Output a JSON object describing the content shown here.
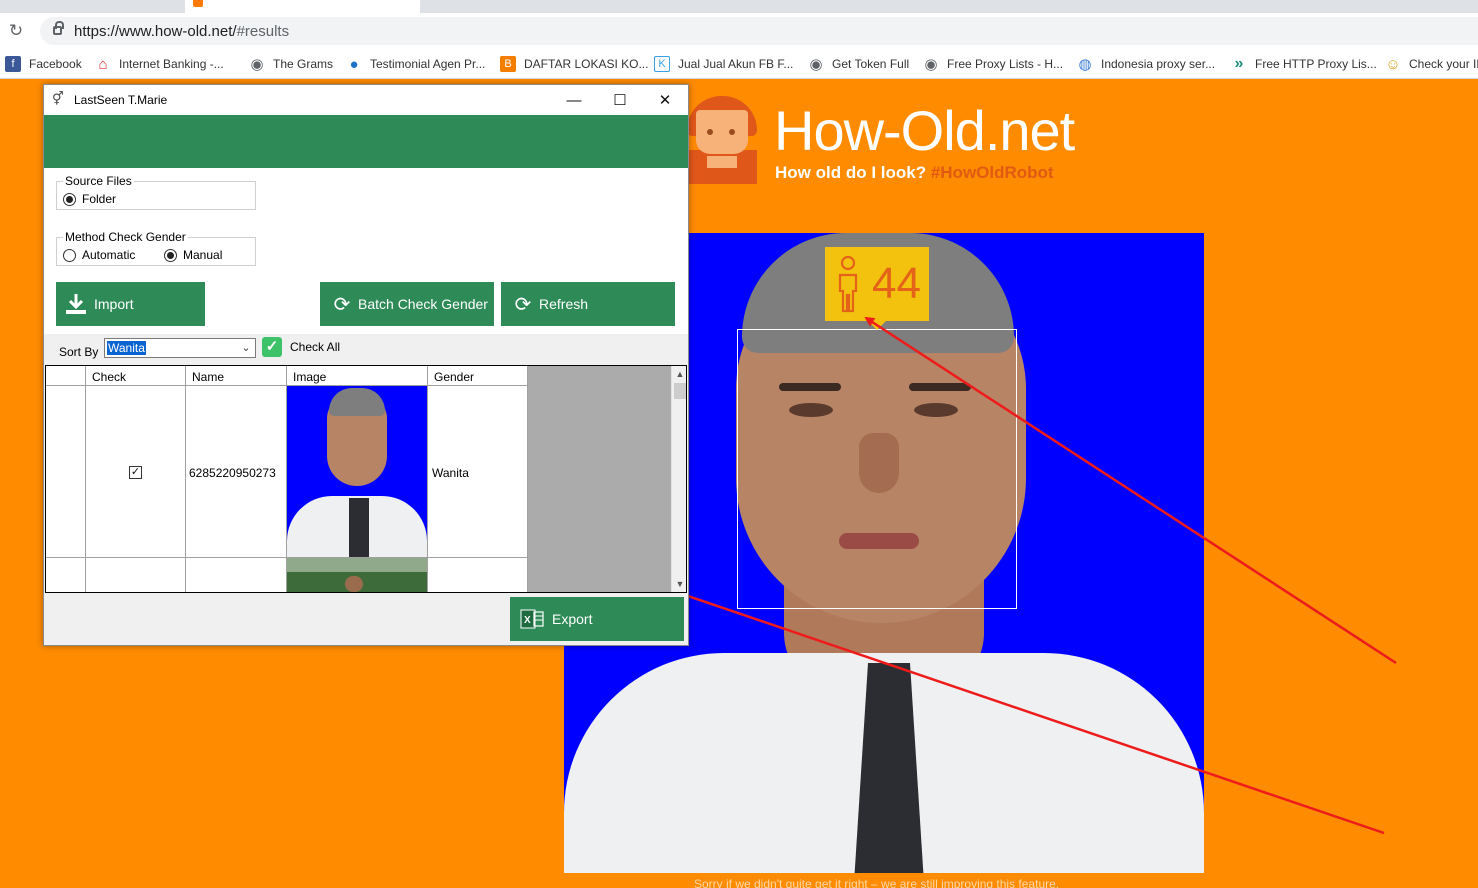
{
  "browser": {
    "url_host": "https://www.how-old.net/",
    "url_hash": "#results",
    "bookmarks": [
      {
        "label": "Facebook",
        "icon": "facebook-icon",
        "color": "#3b5998",
        "glyph": "f"
      },
      {
        "label": "Internet Banking -...",
        "icon": "home-icon",
        "color": "#e22c2c",
        "glyph": "⌂"
      },
      {
        "label": "The Grams",
        "icon": "globe-icon",
        "color": "#5f6368",
        "glyph": "◉"
      },
      {
        "label": "Testimonial Agen Pr...",
        "icon": "pin-icon",
        "color": "#1e73c8",
        "glyph": "●"
      },
      {
        "label": "DAFTAR LOKASI KO...",
        "icon": "blogger-icon",
        "color": "#f57d00",
        "glyph": "B"
      },
      {
        "label": "Jual Jual Akun FB F...",
        "icon": "k-icon",
        "color": "#3aa0e8",
        "glyph": "K"
      },
      {
        "label": "Get Token Full",
        "icon": "globe-icon",
        "color": "#5f6368",
        "glyph": "◉"
      },
      {
        "label": "Free Proxy Lists - H...",
        "icon": "globe-icon",
        "color": "#5f6368",
        "glyph": "◉"
      },
      {
        "label": "Indonesia proxy ser...",
        "icon": "world-icon",
        "color": "#3a7bd5",
        "glyph": "◍"
      },
      {
        "label": "Free HTTP Proxy Lis...",
        "icon": "chevrons-icon",
        "color": "#1f8f7a",
        "glyph": "»"
      },
      {
        "label": "Check your IP",
        "icon": "face-icon",
        "color": "#d9a21b",
        "glyph": "☺"
      }
    ]
  },
  "site": {
    "title": "How-Old.net",
    "subtitle": "How old do I look?",
    "hashtag": "#HowOldRobot",
    "age": "44",
    "footnote": "Sorry if we didn't quite get it right – we are still improving this feature."
  },
  "app": {
    "title": "LastSeen T.Marie",
    "source_group": "Source Files",
    "source_option": "Folder",
    "method_group": "Method Check Gender",
    "method_automatic": "Automatic",
    "method_manual": "Manual",
    "import_label": "Import",
    "batch_label": "Batch Check Gender",
    "refresh_label": "Refresh",
    "sort_label": "Sort By",
    "sort_value": "Wanita",
    "check_all_label": "Check All",
    "export_label": "Export",
    "columns": [
      "Check",
      "Name",
      "Image",
      "Gender"
    ],
    "rows": [
      {
        "checked": true,
        "name": "6285220950273",
        "gender": "Wanita"
      },
      {
        "checked": false,
        "name": "",
        "gender": ""
      }
    ]
  },
  "colors": {
    "page_bg": "#fe8b00",
    "app_green": "#2e8a57",
    "age_badge": "#f2c20f",
    "photo_bg": "#0000ff",
    "arrow": "#ee1b1b"
  }
}
